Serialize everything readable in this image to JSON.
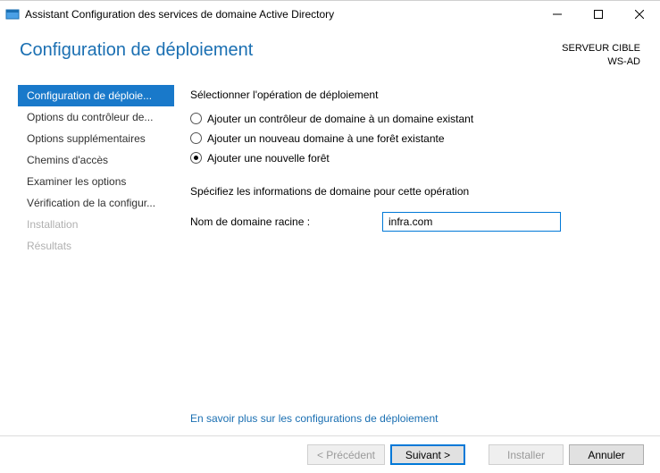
{
  "window": {
    "title": "Assistant Configuration des services de domaine Active Directory"
  },
  "header": {
    "page_title": "Configuration de déploiement",
    "target_label": "SERVEUR CIBLE",
    "target_server": "WS-AD"
  },
  "sidebar": {
    "items": [
      {
        "label": "Configuration de déploie...",
        "state": "selected"
      },
      {
        "label": "Options du contrôleur de...",
        "state": "normal"
      },
      {
        "label": "Options supplémentaires",
        "state": "normal"
      },
      {
        "label": "Chemins d'accès",
        "state": "normal"
      },
      {
        "label": "Examiner les options",
        "state": "normal"
      },
      {
        "label": "Vérification de la configur...",
        "state": "normal"
      },
      {
        "label": "Installation",
        "state": "disabled"
      },
      {
        "label": "Résultats",
        "state": "disabled"
      }
    ]
  },
  "main": {
    "operation_prompt": "Sélectionner l'opération de déploiement",
    "radios": [
      {
        "label": "Ajouter un contrôleur de domaine à un domaine existant",
        "checked": false
      },
      {
        "label": "Ajouter un nouveau domaine à une forêt existante",
        "checked": false
      },
      {
        "label": "Ajouter une nouvelle forêt",
        "checked": true
      }
    ],
    "specify_prompt": "Spécifiez les informations de domaine pour cette opération",
    "root_domain_label": "Nom de domaine racine :",
    "root_domain_value": "infra.com",
    "more_link": "En savoir plus sur les configurations de déploiement"
  },
  "footer": {
    "previous": "< Précédent",
    "next": "Suivant >",
    "install": "Installer",
    "cancel": "Annuler"
  }
}
